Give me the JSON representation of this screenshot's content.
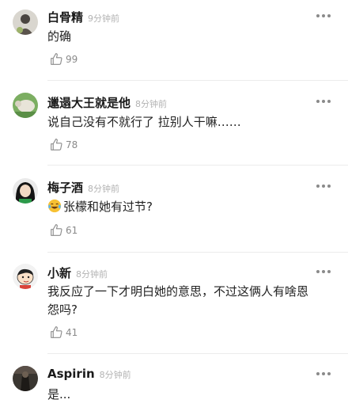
{
  "comments": [
    {
      "name": "白骨精",
      "time": "9分钟前",
      "text": "的确",
      "likes": "99",
      "avatar": "grey-figure-avatar"
    },
    {
      "name": "邋遢大王就是他",
      "time": "8分钟前",
      "text": "说自己没有不就行了 拉别人干嘛……",
      "likes": "78",
      "avatar": "green-sheep-avatar"
    },
    {
      "name": "梅子酒",
      "time": "8分钟前",
      "text": "张檬和她有过节?",
      "emoji": "laughing-tears-emoji",
      "likes": "61",
      "avatar": "dark-hair-girl-avatar"
    },
    {
      "name": "小新",
      "time": "8分钟前",
      "text": "我反应了一下才明白她的意思，不过这俩人有啥恩",
      "text2": "怨吗?",
      "likes": "41",
      "avatar": "cartoon-boy-avatar"
    },
    {
      "name": "Aspirin",
      "time": "8分钟前",
      "text": "是...",
      "avatar": "dark-photo-avatar"
    }
  ]
}
